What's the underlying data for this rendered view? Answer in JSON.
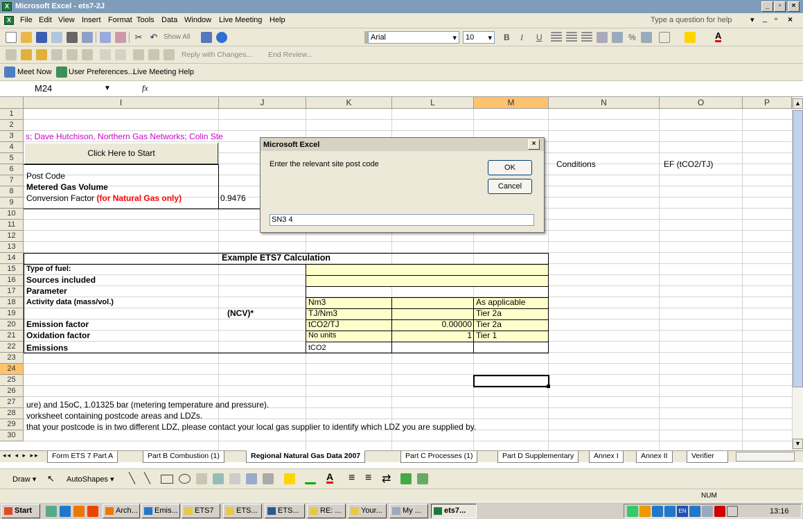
{
  "window": {
    "title": "Microsoft Excel - ets7-2J",
    "app_icon": "excel-icon"
  },
  "menu": [
    "File",
    "Edit",
    "View",
    "Insert",
    "Format",
    "Tools",
    "Data",
    "Window",
    "Live Meeting",
    "Help"
  ],
  "help_box": {
    "placeholder": "Type a question for help"
  },
  "toolbar": {
    "show_all": "Show All",
    "font": "Arial",
    "size": "10",
    "bold": "B",
    "italic": "I",
    "underline": "U",
    "percent": "%",
    "reply": "Reply with Changes...",
    "end_review": "End Review..."
  },
  "meeting_bar": {
    "meet_now": "Meet Now",
    "prefs": "User Preferences...",
    "help": "Live Meeting Help"
  },
  "formula_bar": {
    "cell_ref": "M24",
    "fx": "fx"
  },
  "columns": [
    "I",
    "J",
    "K",
    "L",
    "M",
    "N",
    "O",
    "P"
  ],
  "selected_col": "M",
  "rows": [
    "1",
    "2",
    "3",
    "4",
    "5",
    "6",
    "7",
    "8",
    "9",
    "10",
    "11",
    "12",
    "13",
    "14",
    "15",
    "16",
    "17",
    "18",
    "19",
    "20",
    "21",
    "22",
    "23",
    "24",
    "25",
    "26",
    "27",
    "28",
    "29",
    "30"
  ],
  "selected_row": "24",
  "cells": {
    "r3": "s; Dave Hutchison, Northern Gas Networks; Colin Ste",
    "start_button": "Click Here to Start",
    "n5": "Conditions",
    "o5": "EF (tCO2/TJ)",
    "i6": "Post Code",
    "i7": "Metered Gas Volume",
    "i8_a": "Conversion Factor ",
    "i8_b": "(for Natural Gas only)",
    "j8": "0.9476",
    "title13": "Example ETS7 Calculation",
    "i14": "Type of fuel:",
    "i15": "Sources included",
    "i16": "Parameter",
    "i17": "Activity data (mass/vol.)",
    "k17": "Nm3",
    "m17": "As applicable",
    "j18": "(NCV)*",
    "k18": "TJ/Nm3",
    "m18": "Tier 2a",
    "i19": "Emission factor",
    "k19": "tCO2/TJ",
    "l19": "0.00000",
    "m19": "Tier 2a",
    "i20": "Oxidation factor",
    "k20": "No units",
    "l20": "1",
    "m20": "Tier 1",
    "i21": "Emissions",
    "k21": "tCO2",
    "r26": "ure) and 15oC, 1.01325 bar (metering temperature and pressure).",
    "r27": "vorksheet containing postcode areas and LDZs.",
    "r28": "that your postcode is in two different LDZ, please contact your local gas supplier to identify which LDZ you are supplied by."
  },
  "dialog": {
    "title": "Microsoft Excel",
    "prompt": "Enter the relevant site post code",
    "ok": "OK",
    "cancel": "Cancel",
    "input_value": "SN3 4"
  },
  "sheet_tabs": [
    "Form ETS 7 Part A",
    "Part B Combustion (1)",
    "Regional Natural Gas Data 2007",
    "Part C Processes (1)",
    "Part D Supplementary",
    "Annex I",
    "Annex II",
    "Verifier"
  ],
  "active_tab": "Regional Natural Gas Data 2007",
  "drawbar": {
    "draw": "Draw",
    "autoshapes": "AutoShapes"
  },
  "status": {
    "num": "NUM"
  },
  "taskbar": {
    "start": "Start",
    "items": [
      "Arch...",
      "Emis...",
      "ETS7",
      "ETS...",
      "ETS...",
      "RE: ...",
      "Your...",
      "My ...",
      "ets7..."
    ],
    "time": "13:16",
    "lang": "EN"
  },
  "colors": {
    "selection_header": "#ffc370",
    "input_fill": "#ffffcc",
    "pink_text": "#cc00cc",
    "red_text": "#ff0000"
  }
}
